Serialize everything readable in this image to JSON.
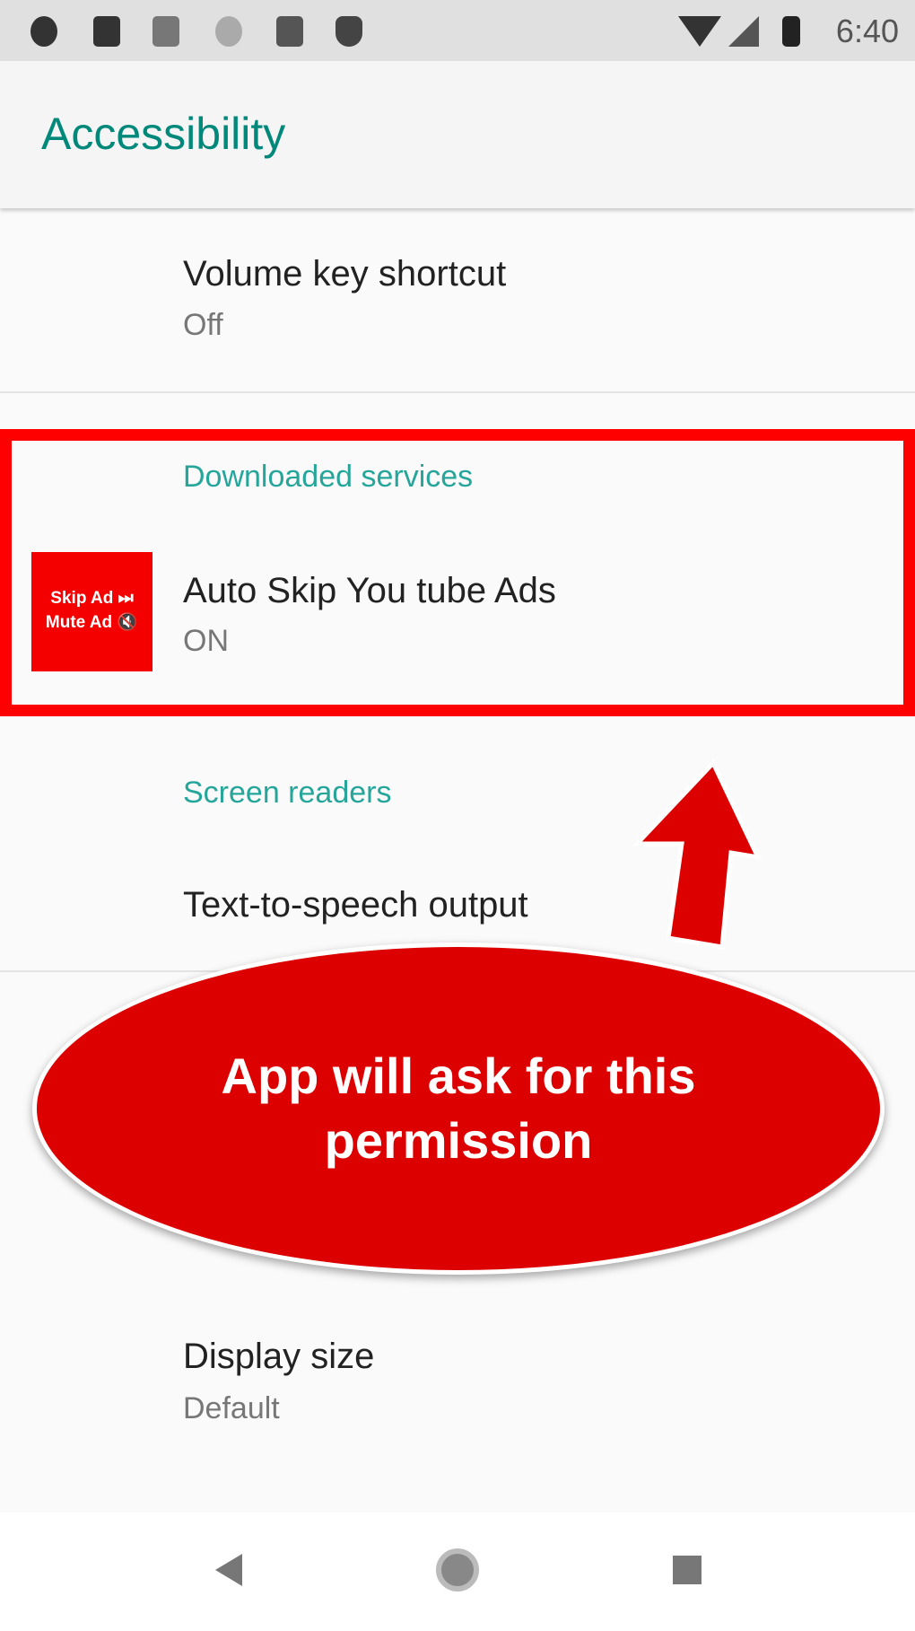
{
  "status_bar": {
    "time": "6:40",
    "icons": [
      "gear-icon",
      "download-icon",
      "gmail-icon",
      "circle-icon",
      "sd-card-icon",
      "shield-icon",
      "wifi-icon",
      "signal-icon",
      "battery-icon"
    ]
  },
  "header": {
    "title": "Accessibility"
  },
  "items": {
    "volume": {
      "title": "Volume key shortcut",
      "summary": "Off"
    },
    "downloaded_category": "Downloaded services",
    "app": {
      "title": "Auto Skip You tube Ads",
      "summary": "ON",
      "icon_line1": "Skip Ad ⏭",
      "icon_line2": "Mute Ad 🔇"
    },
    "screen_readers_category": "Screen readers",
    "tts": {
      "title": "Text-to-speech output"
    },
    "display": {
      "title": "Display size",
      "summary": "Default"
    }
  },
  "annotation": {
    "text": "App will ask for this permission",
    "color": "#dd0000",
    "highlight_color": "#ff0000"
  },
  "nav": {
    "icons": [
      "back-icon",
      "home-icon",
      "recents-icon"
    ]
  }
}
